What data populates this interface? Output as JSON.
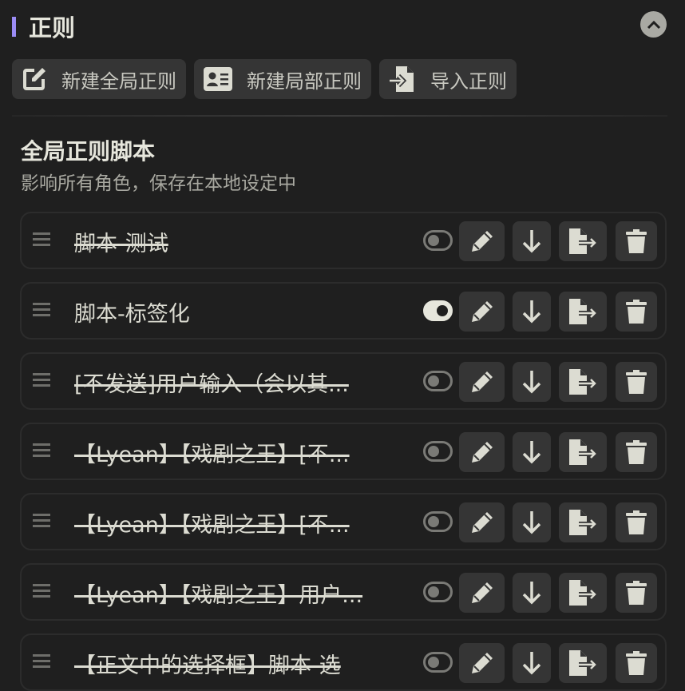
{
  "header": {
    "title": "正则",
    "accent": "#9b8cf5"
  },
  "toolbar": {
    "new_global": "新建全局正则",
    "new_local": "新建局部正则",
    "import": "导入正则"
  },
  "section": {
    "title": "全局正则脚本",
    "subtitle": "影响所有角色，保存在本地设定中"
  },
  "scripts": [
    {
      "name": "脚本-测试",
      "enabled": false
    },
    {
      "name": "脚本-标签化",
      "enabled": true
    },
    {
      "name": "[不发送]用户输入（会以其...",
      "enabled": false
    },
    {
      "name": "【Lyean】【戏剧之王】[不...",
      "enabled": false
    },
    {
      "name": "【Lyean】【戏剧之王】[不...",
      "enabled": false
    },
    {
      "name": "【Lyean】【戏剧之王】用户...",
      "enabled": false
    },
    {
      "name": "【正文中的选择框】脚本-选",
      "enabled": false
    }
  ]
}
